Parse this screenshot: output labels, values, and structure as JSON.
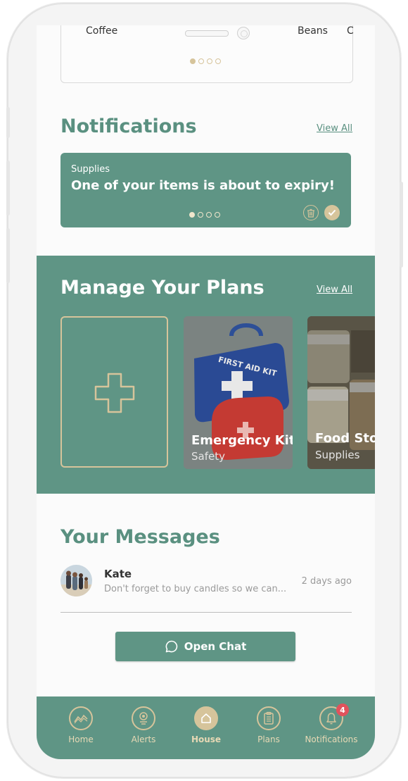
{
  "top_carousel": {
    "items": [
      "Coffee",
      "Beans",
      "C"
    ]
  },
  "notifications": {
    "title": "Notifications",
    "view_all": "View All",
    "card": {
      "category": "Supplies",
      "message": "One of your items is about to expiry!"
    }
  },
  "plans": {
    "title": "Manage Your Plans",
    "view_all": "View All",
    "cards": [
      {
        "title": "Emergency Kit",
        "subtitle": "Safety"
      },
      {
        "title": "Food Stock",
        "subtitle": "Supplies"
      }
    ]
  },
  "messages": {
    "title": "Your Messages",
    "items": [
      {
        "name": "Kate",
        "preview": "Don't forget to buy candles so we can...",
        "time": "2 days ago"
      }
    ],
    "open_chat": "Open Chat"
  },
  "tabbar": {
    "tabs": [
      {
        "label": "Home",
        "icon": "chart-icon"
      },
      {
        "label": "Alerts",
        "icon": "location-pin-icon"
      },
      {
        "label": "House",
        "icon": "house-icon",
        "active": true
      },
      {
        "label": "Plans",
        "icon": "clipboard-icon"
      },
      {
        "label": "Notifications",
        "icon": "bell-icon",
        "badge": "4"
      }
    ]
  },
  "colors": {
    "primary": "#5f9585",
    "accent": "#d6c49b",
    "badge": "#e2525c"
  }
}
